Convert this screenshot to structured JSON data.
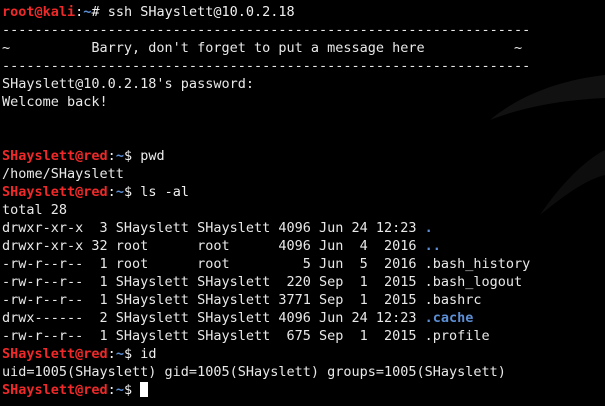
{
  "prompts": {
    "root": {
      "user": "root@kali",
      "sep": ":",
      "path": "~",
      "symbol": "# ",
      "command": "ssh SHayslett@10.0.2.18"
    },
    "remote_pwd": {
      "user": "SHayslett@red",
      "sep": ":",
      "path": "~",
      "symbol": "$ ",
      "command": "pwd"
    },
    "remote_ls": {
      "user": "SHayslett@red",
      "sep": ":",
      "path": "~",
      "symbol": "$ ",
      "command": "ls -al"
    },
    "remote_id": {
      "user": "SHayslett@red",
      "sep": ":",
      "path": "~",
      "symbol": "$ ",
      "command": "id"
    },
    "remote_last": {
      "user": "SHayslett@red",
      "sep": ":",
      "path": "~",
      "symbol": "$ ",
      "command": ""
    }
  },
  "banner": {
    "rule": "-----------------------------------------------------------------",
    "message": "~          Barry, don't forget to put a message here           ~"
  },
  "login": {
    "password_prompt": "SHayslett@10.0.2.18's password:",
    "welcome": "Welcome back!"
  },
  "pwd_output": "/home/SHayslett",
  "ls_total": "total 28",
  "ls_entries": [
    {
      "prefix": "drwxr-xr-x  3 SHayslett SHayslett 4096 Jun 24 12:23 ",
      "name": "."
    },
    {
      "prefix": "drwxr-xr-x 32 root      root      4096 Jun  4  2016 ",
      "name": ".."
    },
    {
      "prefix": "-rw-r--r--  1 root      root         5 Jun  5  2016 ",
      "name": ".bash_history"
    },
    {
      "prefix": "-rw-r--r--  1 SHayslett SHayslett  220 Sep  1  2015 ",
      "name": ".bash_logout"
    },
    {
      "prefix": "-rw-r--r--  1 SHayslett SHayslett 3771 Sep  1  2015 ",
      "name": ".bashrc"
    },
    {
      "prefix": "drwx------  2 SHayslett SHayslett 4096 Jun 24 12:23 ",
      "name": ".cache"
    },
    {
      "prefix": "-rw-r--r--  1 SHayslett SHayslett  675 Sep  1  2015 ",
      "name": ".profile"
    }
  ],
  "id_output": "uid=1005(SHayslett) gid=1005(SHayslett) groups=1005(SHayslett)",
  "colors": {
    "background": "#000000",
    "text": "#e9e9e9",
    "prompt_user": "#ef2929",
    "path_and_dirs": "#5c8fd6"
  }
}
